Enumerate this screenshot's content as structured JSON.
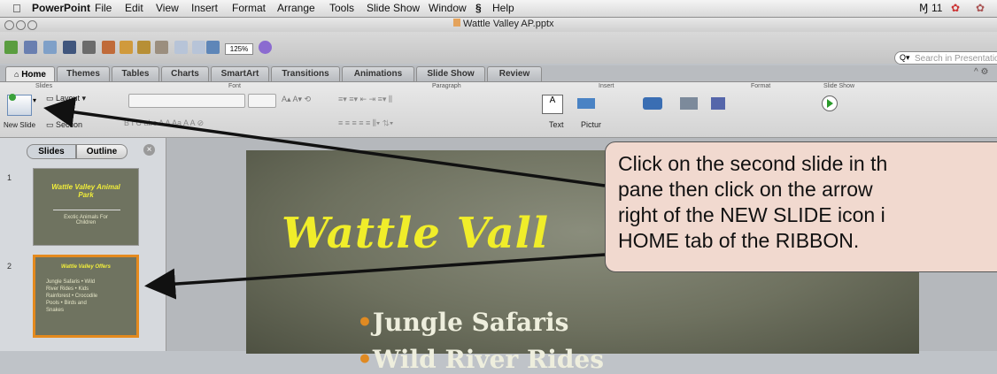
{
  "menubar": {
    "apple": "",
    "app": "PowerPoint",
    "items": [
      "File",
      "Edit",
      "View",
      "Insert",
      "Format",
      "Arrange",
      "Tools",
      "Slide Show",
      "Window",
      "",
      "Help"
    ],
    "right": "11"
  },
  "window": {
    "title": "Wattle Valley AP.pptx"
  },
  "toolbar": {
    "zoom": "125%",
    "search_placeholder": "Search in Presentation"
  },
  "tabs": [
    "Home",
    "Themes",
    "Tables",
    "Charts",
    "SmartArt",
    "Transitions",
    "Animations",
    "Slide Show",
    "Review"
  ],
  "ribbon": {
    "groups": {
      "slides": "Slides",
      "font": "Font",
      "paragraph": "Paragraph",
      "insert": "Insert",
      "format": "Format",
      "slideshow": "Slide Show"
    },
    "new_slide": "New Slide",
    "layout": "Layout",
    "section": "Section",
    "text": "Text",
    "picture": "Pictur"
  },
  "pane": {
    "tabs": [
      "Slides",
      "Outline"
    ],
    "slides": [
      {
        "num": "1",
        "title": "Wattle Valley Animal Park",
        "sub": "Exotic Animals For Children"
      },
      {
        "num": "2",
        "title": "Wattle Valley Offers",
        "sub": "Jungle Safaris • Wild River Rides • Kids Rainforest • Crocodile Pools • Birds and Snakes"
      }
    ]
  },
  "slide": {
    "title": "Wattle Vall",
    "bullets": [
      "Jungle Safaris",
      "Wild River Rides"
    ]
  },
  "callout": {
    "text": "Click on the second slide in th\npane then click on the arrow\nright of the NEW SLIDE icon i\nHOME tab of the RIBBON."
  }
}
